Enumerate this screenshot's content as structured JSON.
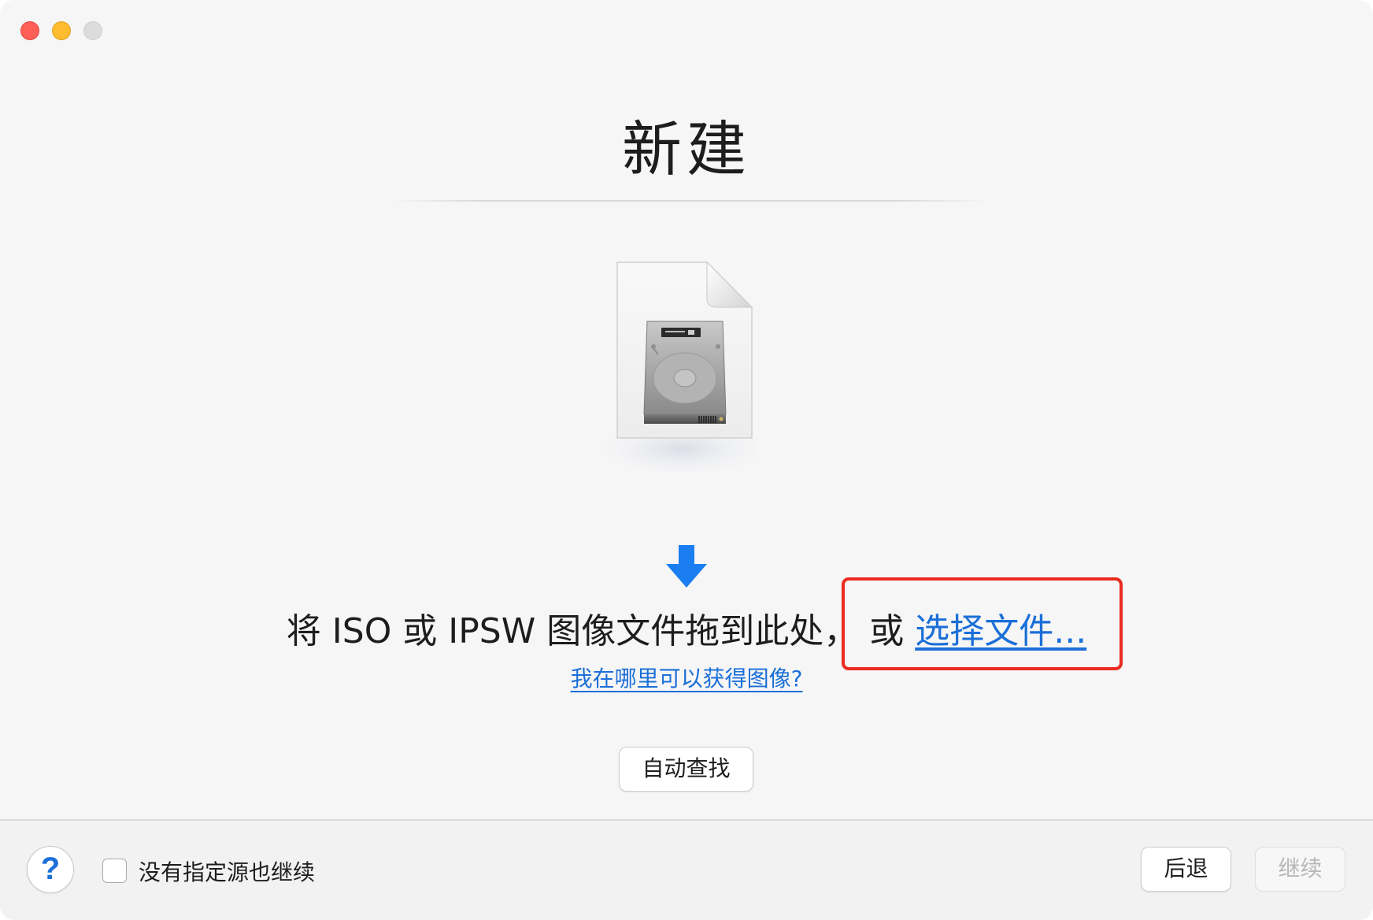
{
  "window": {
    "title": "新建"
  },
  "drop_area": {
    "instruction": "将 ISO 或 IPSW 图像文件拖到此处，",
    "or_text": "或",
    "choose_file_label": "选择文件...",
    "help_link": "我在哪里可以获得图像?"
  },
  "auto_find_label": "自动查找",
  "footer": {
    "help_label": "?",
    "checkbox_label": "没有指定源也继续",
    "checkbox_checked": false,
    "back_label": "后退",
    "continue_label": "继续",
    "continue_enabled": false
  },
  "icons": {
    "file": "disk-image-file-icon",
    "arrow": "down-arrow-icon"
  },
  "colors": {
    "link": "#1b6fd8",
    "arrow": "#1a7ef0",
    "highlight": "#ea2b1f",
    "close": "#fe5f57",
    "minimize": "#febc2e",
    "zoom_disabled": "#dcdcdc"
  }
}
